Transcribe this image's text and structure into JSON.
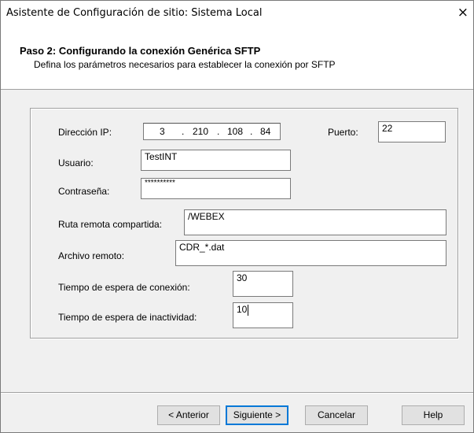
{
  "window": {
    "title": "Asistente de Configuración de sitio: Sistema Local",
    "close_glyph": "×"
  },
  "header": {
    "step_title": "Paso 2: Configurando la conexión Genérica SFTP",
    "step_subtitle": "Defina los parámetros necesarios para establecer la conexión por SFTP"
  },
  "form": {
    "ip_label": "Dirección IP:",
    "ip_octets": [
      "3",
      "210",
      "108",
      "84"
    ],
    "ip_dot": ".",
    "port_label": "Puerto:",
    "port_value": "22",
    "user_label": "Usuario:",
    "user_value": "TestINT",
    "password_label": "Contraseña:",
    "password_value": "**********",
    "remote_path_label": "Ruta remota compartida:",
    "remote_path_value": "/WEBEX",
    "remote_file_label": "Archivo remoto:",
    "remote_file_value": "CDR_*.dat",
    "connect_timeout_label": "Tiempo de espera de conexión:",
    "connect_timeout_value": "30",
    "idle_timeout_label": "Tiempo de espera de inactividad:",
    "idle_timeout_value": "10"
  },
  "buttons": {
    "back": "< Anterior",
    "next": "Siguiente >",
    "cancel": "Cancelar",
    "help": "Help"
  }
}
